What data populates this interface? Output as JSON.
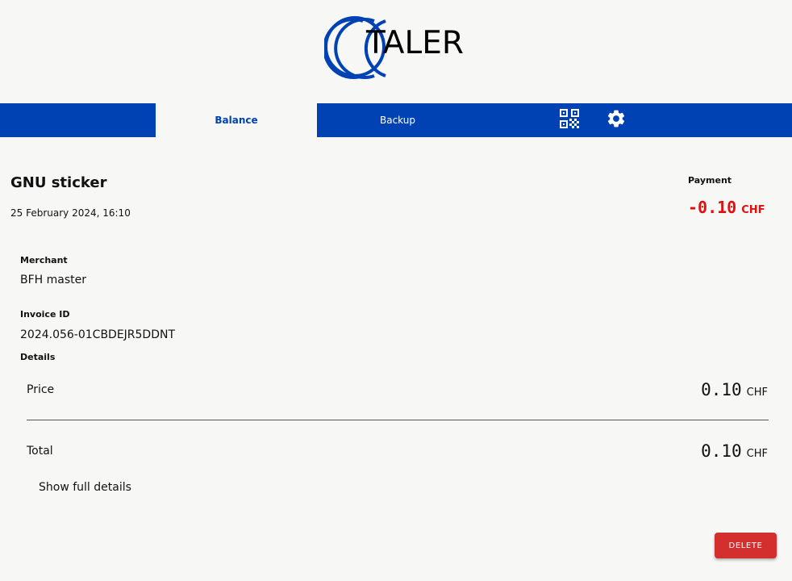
{
  "brand": {
    "logo_text": "TALER",
    "logo_color": "#0042b3"
  },
  "nav": {
    "background": "#0042b3",
    "tabs": [
      {
        "label": "Balance",
        "active": true
      },
      {
        "label": "Backup",
        "active": false
      }
    ],
    "icons": [
      "qr-code-icon",
      "gear-icon"
    ]
  },
  "transaction": {
    "title": "GNU sticker",
    "date": "25 February 2024, 16:10",
    "type_label": "Payment",
    "amount": "-0.10",
    "currency": "CHF",
    "amount_color": "#e01010"
  },
  "fields": {
    "merchant_label": "Merchant",
    "merchant_value": "BFH master",
    "invoice_label": "Invoice ID",
    "invoice_value": "2024.056-01CBDEJR5DDNT",
    "details_label": "Details"
  },
  "details": {
    "price_label": "Price",
    "price_amount": "0.10",
    "price_currency": "CHF",
    "total_label": "Total",
    "total_amount": "0.10",
    "total_currency": "CHF",
    "show_full_label": "Show full details"
  },
  "actions": {
    "delete_label": "DELETE",
    "delete_color": "#d32f2f"
  }
}
